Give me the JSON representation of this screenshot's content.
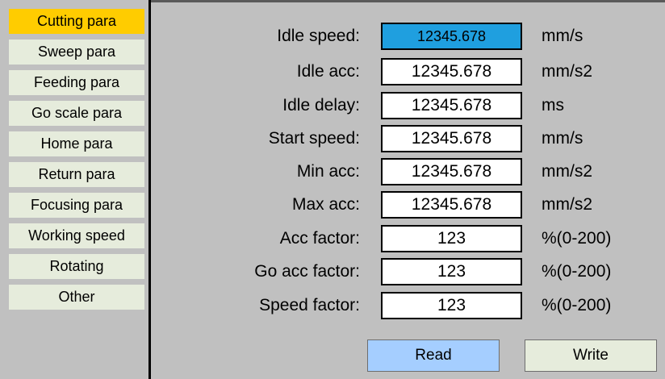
{
  "sidebar": {
    "items": [
      {
        "label": "Cutting para",
        "active": true
      },
      {
        "label": "Sweep para"
      },
      {
        "label": "Feeding para"
      },
      {
        "label": "Go scale para"
      },
      {
        "label": "Home para"
      },
      {
        "label": "Return para"
      },
      {
        "label": "Focusing para"
      },
      {
        "label": "Working speed"
      },
      {
        "label": "Rotating"
      },
      {
        "label": "Other"
      }
    ]
  },
  "params": {
    "rows": [
      {
        "label": "Idle speed:",
        "value": "12345.678",
        "unit": "mm/s",
        "selected": true
      },
      {
        "label": "Idle acc:",
        "value": "12345.678",
        "unit": "mm/s2"
      },
      {
        "label": "Idle delay:",
        "value": "12345.678",
        "unit": "ms"
      },
      {
        "label": "Start speed:",
        "value": "12345.678",
        "unit": "mm/s"
      },
      {
        "label": "Min acc:",
        "value": "12345.678",
        "unit": "mm/s2"
      },
      {
        "label": "Max acc:",
        "value": "12345.678",
        "unit": "mm/s2"
      },
      {
        "label": "Acc factor:",
        "value": "123",
        "unit": "%(0-200)"
      },
      {
        "label": "Go acc factor:",
        "value": "123",
        "unit": "%(0-200)"
      },
      {
        "label": "Speed factor:",
        "value": "123",
        "unit": "%(0-200)"
      }
    ]
  },
  "buttons": {
    "read_label": "Read",
    "write_label": "Write"
  },
  "colors": {
    "active_tab": "#ffcc00",
    "tab": "#e6ecdc",
    "selected_field": "#1f9fdf",
    "read_button": "#a5ceff",
    "background": "#c0c0c0"
  }
}
